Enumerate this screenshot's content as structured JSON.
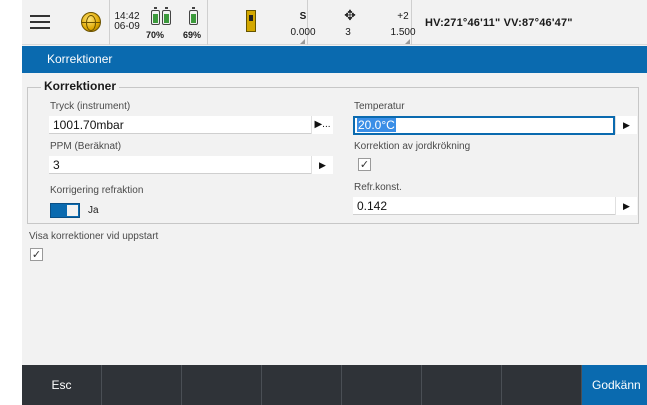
{
  "status_bar": {
    "time": "14:42",
    "date": "06-09",
    "battery_1_pct": "70%",
    "battery_2_pct": "69%",
    "battery_1_level": 0.7,
    "battery_2_level": 0.69,
    "mode_label": "S",
    "mode_value": "0.000",
    "target_value": "3",
    "prism_label": "+2",
    "prism_value": "1.500",
    "angles": "HV:271°46'11\"  VV:87°46'47\""
  },
  "title": "Korrektioner",
  "group": {
    "legend": "Korrektioner",
    "pressure": {
      "label": "Tryck (instrument)",
      "value": "1001.70mbar",
      "button": "▶..."
    },
    "temperature": {
      "label": "Temperatur",
      "value": "20.0°C",
      "button": "▶"
    },
    "ppm": {
      "label": "PPM (Beräknat)",
      "value": "3",
      "button": "▶"
    },
    "curvature": {
      "label": "Korrektion av jordkrökning",
      "checked": "✓"
    },
    "refraction": {
      "label": "Korrigering refraktion",
      "toggle_text": "Ja"
    },
    "refr_const": {
      "label": "Refr.konst.",
      "value": "0.142",
      "button": "▶"
    }
  },
  "startup": {
    "label": "Visa korrektioner vid uppstart",
    "checked": "✓"
  },
  "bottom_bar": {
    "esc": "Esc",
    "accept": "Godkänn"
  },
  "colors": {
    "accent": "#0a6aaf",
    "bottom": "#2f3338"
  },
  "icons": [
    "menu-icon",
    "globe-icon",
    "battery-icon",
    "instrument-icon",
    "target-icon"
  ]
}
